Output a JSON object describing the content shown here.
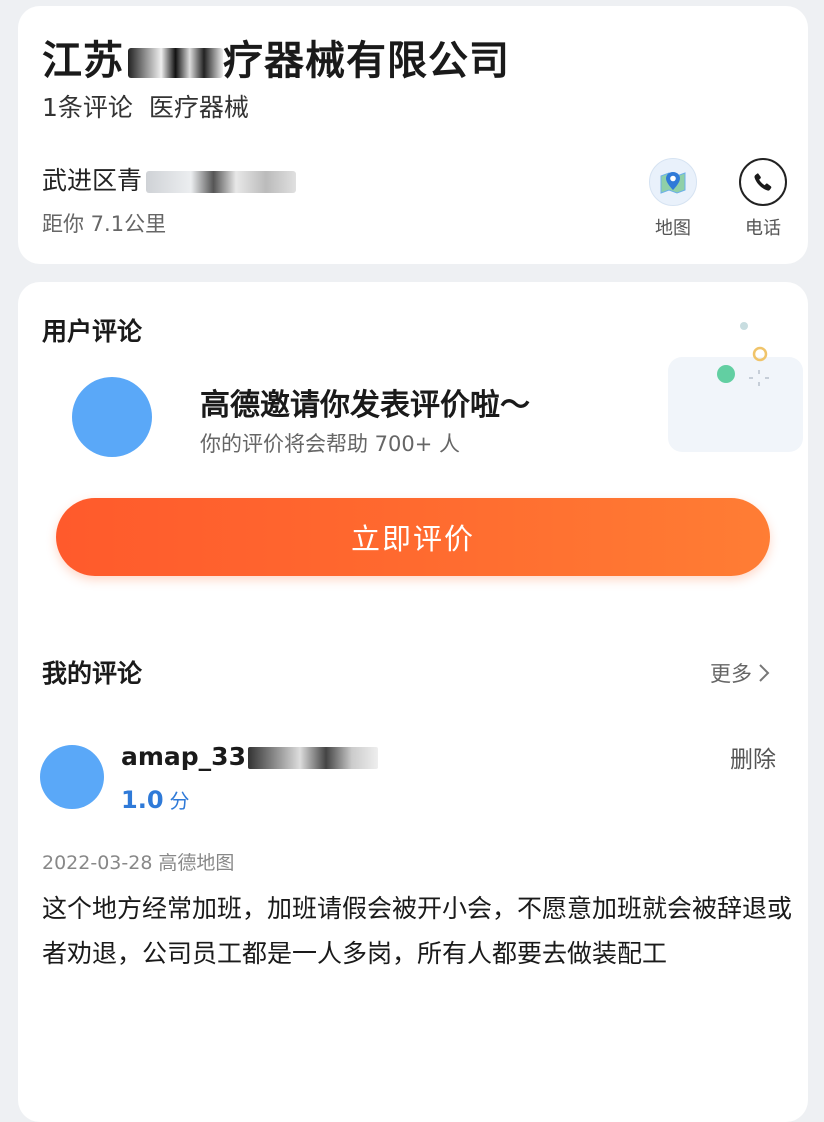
{
  "poi": {
    "title": "江苏",
    "title_suffix": "疗器械有限公司",
    "review_count": "1条评论",
    "category": "医疗器械",
    "address": "武进区青",
    "distance": "距你 7.1公里",
    "actions": {
      "map_label": "地图",
      "phone_label": "电话"
    }
  },
  "user_reviews": {
    "title": "用户评论",
    "invite_title": "高德邀请你发表评价啦～",
    "invite_subtitle": "你的评价将会帮助 700+ 人",
    "rate_button": "立即评价"
  },
  "my_reviews": {
    "title": "我的评论",
    "more_label": "更多",
    "review": {
      "username": "amap_33",
      "score": "1.0",
      "score_unit": "分",
      "delete_label": "删除",
      "date": "2022-03-28",
      "source": "高德地图",
      "text": "这个地方经常加班，加班请假会被开小会，不愿意加班就会被辞退或者劝退，公司员工都是一人多岗，所有人都要去做装配工"
    }
  },
  "colors": {
    "accent_blue": "#2f7ad8",
    "avatar_blue": "#5aa8f8",
    "button_orange": "#ff6a2f"
  }
}
